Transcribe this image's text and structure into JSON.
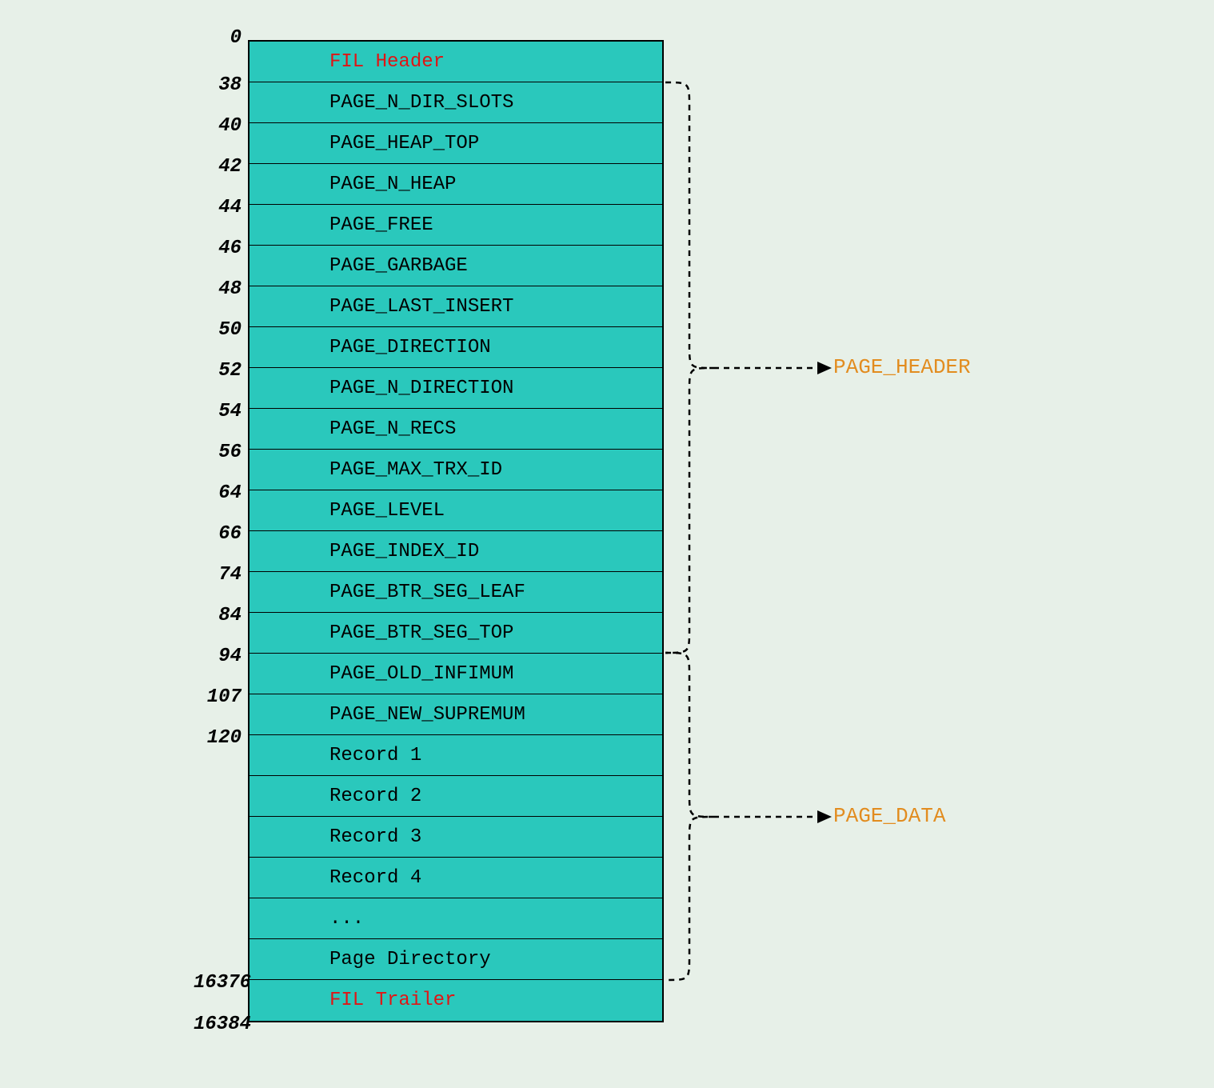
{
  "offsets": {
    "o0": "0",
    "o38": "38",
    "o40": "40",
    "o42": "42",
    "o44": "44",
    "o46": "46",
    "o48": "48",
    "o50": "50",
    "o52": "52",
    "o54": "54",
    "o56": "56",
    "o64": "64",
    "o66": "66",
    "o74": "74",
    "o84": "84",
    "o94": "94",
    "o107": "107",
    "o120": "120",
    "o16376": "16376",
    "o16384": "16384"
  },
  "rows": {
    "fil_header": "FIL Header",
    "page_n_dir_slots": "PAGE_N_DIR_SLOTS",
    "page_heap_top": "PAGE_HEAP_TOP",
    "page_n_heap": "PAGE_N_HEAP",
    "page_free": "PAGE_FREE",
    "page_garbage": "PAGE_GARBAGE",
    "page_last_insert": "PAGE_LAST_INSERT",
    "page_direction": "PAGE_DIRECTION",
    "page_n_direction": "PAGE_N_DIRECTION",
    "page_n_recs": "PAGE_N_RECS",
    "page_max_trx_id": "PAGE_MAX_TRX_ID",
    "page_level": "PAGE_LEVEL",
    "page_index_id": "PAGE_INDEX_ID",
    "page_btr_seg_leaf": "PAGE_BTR_SEG_LEAF",
    "page_btr_seg_top": "PAGE_BTR_SEG_TOP",
    "page_old_infimum": "PAGE_OLD_INFIMUM",
    "page_new_supremum": "PAGE_NEW_SUPREMUM",
    "record1": "Record 1",
    "record2": "Record 2",
    "record3": "Record 3",
    "record4": "Record 4",
    "ellipsis": "...",
    "page_directory": "Page Directory",
    "fil_trailer": "FIL Trailer"
  },
  "annotations": {
    "page_header": "PAGE_HEADER",
    "page_data": "PAGE_DATA"
  }
}
